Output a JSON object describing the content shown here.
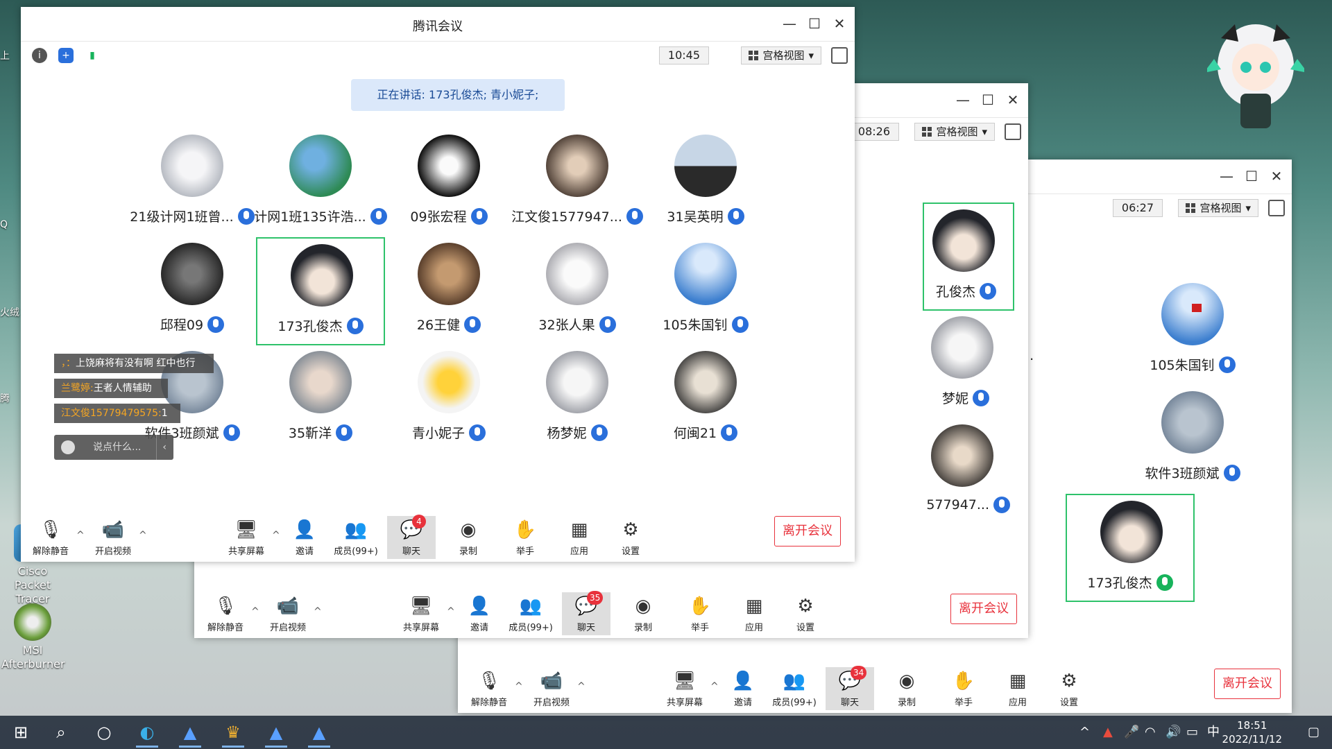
{
  "desktop": {
    "icons": [
      {
        "label": "Cisco Packet Tracer"
      },
      {
        "label": "MSI Afterburner"
      }
    ],
    "left_edge_text": [
      "上",
      "Q",
      "火绒",
      "腾"
    ]
  },
  "main": {
    "title": "腾讯会议",
    "clock": "10:45",
    "view_mode": "宫格视图",
    "speaking": "正在讲话: 173孔俊杰; 青小妮子;",
    "participants": [
      {
        "name": "21级计网1班曾...",
        "mic": "blue"
      },
      {
        "name": "计网1班135许浩...",
        "mic": "blue"
      },
      {
        "name": "09张宏程",
        "mic": "blue"
      },
      {
        "name": "江文俊1577947...",
        "mic": "blue"
      },
      {
        "name": "31吴英明",
        "mic": "blue"
      },
      {
        "name": "邱程09",
        "mic": "blue"
      },
      {
        "name": "173孔俊杰",
        "mic": "blue",
        "selected": true
      },
      {
        "name": "26王健",
        "mic": "blue"
      },
      {
        "name": "32张人果",
        "mic": "blue"
      },
      {
        "name": "105朱国钊",
        "mic": "blue"
      },
      {
        "name": "软件3班颜斌",
        "mic": "blue"
      },
      {
        "name": "35靳洋",
        "mic": "blue"
      },
      {
        "name": "青小妮子",
        "mic": "blue"
      },
      {
        "name": "杨梦妮",
        "mic": "blue"
      },
      {
        "name": "何闽21",
        "mic": "blue"
      }
    ],
    "chat": [
      {
        "name": "，：",
        "text": "上饶麻将有没有啊 红中也行"
      },
      {
        "name": "兰鹭婷:",
        "text": "王者人情辅助"
      },
      {
        "name": "江文俊15779479575:",
        "text": "1"
      }
    ],
    "chat_placeholder": "说点什么...",
    "toolbar": {
      "unmute": "解除静音",
      "video": "开启视频",
      "share": "共享屏幕",
      "invite": "邀请",
      "members": "成员(99+)",
      "chat": "聊天",
      "chat_badge": "4",
      "record": "录制",
      "raise": "举手",
      "apps": "应用",
      "settings": "设置",
      "leave": "离开会议"
    }
  },
  "second": {
    "clock": "08:26",
    "view_mode": "宫格视图",
    "visible_names": [
      "孔俊杰",
      "梦妮",
      "577947..."
    ],
    "toolbar": {
      "unmute": "解除静音",
      "video": "开启视频",
      "share": "共享屏幕",
      "invite": "邀请",
      "members": "成员(99+)",
      "chat": "聊天",
      "chat_badge": "35",
      "record": "录制",
      "raise": "举手",
      "apps": "应用",
      "settings": "设置",
      "leave": "离开会议"
    }
  },
  "third": {
    "clock": "06:27",
    "view_mode": "宫格视图",
    "participants": [
      {
        "name": "105朱国钊",
        "mic": "blue"
      },
      {
        "name": "软件3班颜斌",
        "mic": "blue"
      },
      {
        "name": "173孔俊杰",
        "mic": "green",
        "selected": true
      }
    ],
    "partial_name": "...",
    "toolbar": {
      "unmute": "解除静音",
      "video": "开启视频",
      "share": "共享屏幕",
      "invite": "邀请",
      "members": "成员(99+)",
      "chat": "聊天",
      "chat_badge": "34",
      "record": "录制",
      "raise": "举手",
      "apps": "应用",
      "settings": "设置",
      "leave": "离开会议"
    }
  },
  "taskbar": {
    "time": "18:51",
    "date": "2022/11/12",
    "ime": "中"
  },
  "colors": {
    "accent": "#2a6fdb",
    "leave": "#e8323c",
    "selected_border": "#2ec26a",
    "badge": "#e8323c"
  }
}
